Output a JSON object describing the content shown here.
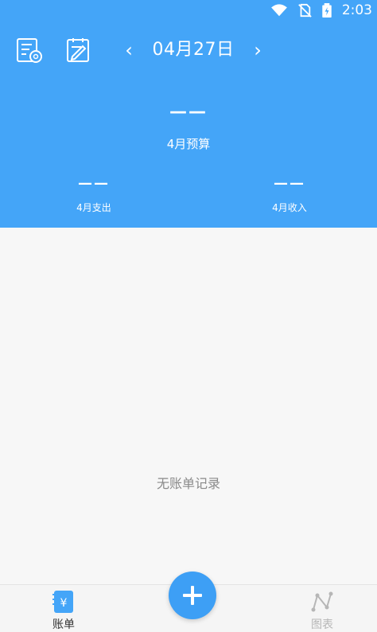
{
  "status_bar": {
    "time": "2:03"
  },
  "header": {
    "date": "04月27日",
    "prev_arrow": "‹",
    "next_arrow": "›",
    "budget_value": "——",
    "budget_label": "4月预算",
    "expense_value": "——",
    "expense_label": "4月支出",
    "income_value": "——",
    "income_label": "4月收入"
  },
  "main": {
    "empty_text": "无账单记录"
  },
  "bottom_nav": {
    "bills_label": "账单",
    "bills_icon_glyph": "¥",
    "chart_label": "图表"
  },
  "colors": {
    "primary": "#44a5f8",
    "fab": "#3d9ff5",
    "background": "#f7f7f7"
  }
}
